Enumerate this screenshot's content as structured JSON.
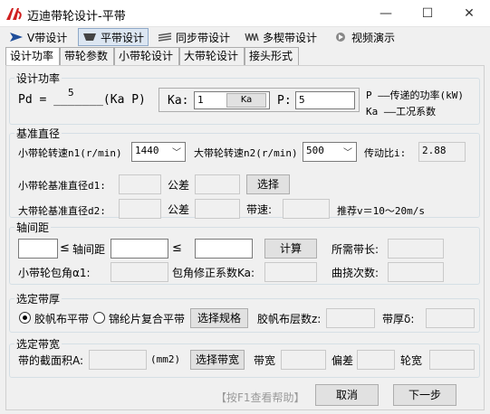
{
  "window": {
    "title": "迈迪带轮设计-平带",
    "min": "—",
    "max": "☐",
    "close": "✕"
  },
  "toolbar": [
    {
      "label": "V带设计",
      "icon": "arrow-right-icon"
    },
    {
      "label": "平带设计",
      "icon": "flat-belt-icon"
    },
    {
      "label": "同步带设计",
      "icon": "timing-belt-icon"
    },
    {
      "label": "多楔带设计",
      "icon": "multi-v-belt-icon"
    },
    {
      "label": "视频演示",
      "icon": "video-icon"
    }
  ],
  "tabs": [
    "设计功率",
    "带轮参数",
    "小带轮设计",
    "大带轮设计",
    "接头形式"
  ],
  "power": {
    "group_title": "设计功率",
    "pd_label": "Pd = _______(Ka P)",
    "pd_value": "5",
    "ka_label": "Ka:",
    "ka_value": "1",
    "ka_button": "Ka",
    "p_label": "P:",
    "p_value": "5",
    "note1": "P ——传递的功率(kW)",
    "note2": "Ka ——工况系数"
  },
  "base": {
    "group_title": "基准直径",
    "n1_label": "小带轮转速n1(r/min)",
    "n1_value": "1440",
    "n2_label": "大带轮转速n2(r/min)",
    "n2_value": "500",
    "ratio_label": "传动比i:",
    "ratio_value": "2.88",
    "d1_label": "小带轮基准直径d1:",
    "tol1_label": "公差",
    "select_button": "选择",
    "d2_label": "大带轮基准直径d2:",
    "tol2_label": "公差",
    "speed_label": "带速:",
    "speed_note": "推荐v＝10～20m/s"
  },
  "axis": {
    "group_title": "轴间距",
    "le1": "≤",
    "axis_label": "轴间距",
    "le2": "≤",
    "calc_button": "计算",
    "len_label": "所需带长:",
    "angle_label": "小带轮包角α1:",
    "corr_label": "包角修正系数Ka:",
    "flex_label": "曲挠次数:"
  },
  "thick": {
    "group_title": "选定带厚",
    "radio1": "胶帆布平带",
    "radio2": "锦纶片复合平带",
    "spec_button": "选择规格",
    "layers_label": "胶帆布层数z:",
    "thickness_label": "带厚δ:"
  },
  "width": {
    "group_title": "选定带宽",
    "area_label": "带的截面积A:",
    "unit": "(mm2)",
    "select_width_button": "选择带宽",
    "width_label": "带宽",
    "dev_label": "偏差",
    "wheel_label": "轮宽"
  },
  "footer": {
    "help": "【按F1查看帮助】",
    "cancel": "取消",
    "next": "下一步"
  }
}
